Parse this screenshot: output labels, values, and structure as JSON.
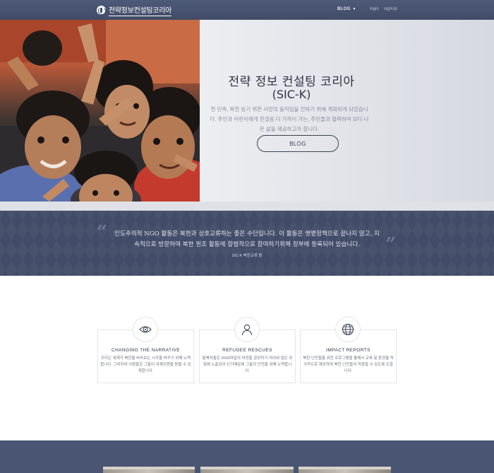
{
  "nav": {
    "brand_name": "전략정보컨설팅코리아",
    "blog_label": "BLOG",
    "login_label": "login",
    "signup_label": "signUp"
  },
  "hero": {
    "title": "전략 정보 컨설팅 코리아",
    "subtitle": "(SIC-K)",
    "description": "현 민족, 북한 동기 위한 사랑의 움직임을 전하기 위해 계획하게 되었습니다. 주민과 어린이에게 한걸음 더 가까이 가는, 주민들과 협력하여 보다 나은 삶을 제공하고자 합니다.",
    "button_label": "BLOG"
  },
  "quote": {
    "text": "인도주의적 NGO 활동은 북한과 상호교류하는 좋은 수단입니다. 이 활동은 햇볕정책으로 끝나지 않고, 지속적으로 방문하며 북한 원조 활동에 합법적으로 참여하기위해 정부에 등록되어 있습니다.",
    "author": "SIC-K 북한교류 팀"
  },
  "features": [
    {
      "icon": "eye-icon",
      "title": "CHANGING THE NARRATIVE",
      "text": "우리는 세계가 북한을 바라보는 시각을 바꾸기 위해 노력합니다. 그리하여 사람들은 그들이 국제지원을 받을 수 있게합니다."
    },
    {
      "icon": "person-icon",
      "title": "REFUGEE RESCUES",
      "text": "탈북자들은 3000마일의 여정을 감당하기 어려워 많은 위험에 노출되어 인기때문에 그들의 안전을 위해 노력합니다."
    },
    {
      "icon": "globe-icon",
      "title": "IMPACT REPORTS",
      "text": "북한 난민들을 위한 프로그램을 통해서 교육 및 환경을 적극적으로 제공하여 북한 난민들이 적응할 수 있도록 도웁니다."
    }
  ],
  "colors": {
    "nav_bg": "#414c67",
    "band_bg": "#424c68",
    "text_dark": "#2f3340"
  }
}
